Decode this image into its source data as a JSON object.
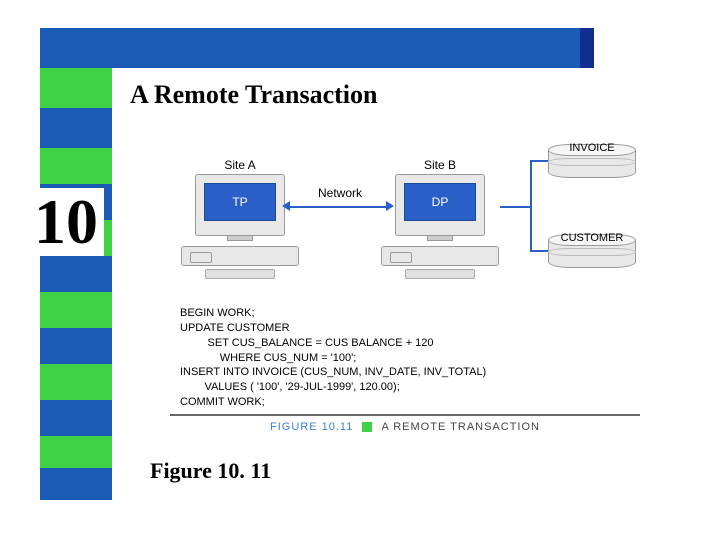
{
  "chapter_number": "10",
  "title": "A Remote Transaction",
  "caption": "Figure 10. 11",
  "diagram": {
    "siteA": {
      "label": "Site A",
      "role": "TP"
    },
    "siteB": {
      "label": "Site B",
      "role": "DP"
    },
    "network_label": "Network",
    "cylinders": {
      "top": "INVOICE",
      "bottom": "CUSTOMER"
    },
    "figure_label": "FIGURE 10.11",
    "figure_title": "A REMOTE TRANSACTION"
  },
  "sql": {
    "l1": "BEGIN WORK;",
    "l2": "UPDATE CUSTOMER",
    "l3": "SET CUS_BALANCE = CUS BALANCE + 120",
    "l4": "WHERE CUS_NUM = '100';",
    "l5": "INSERT INTO INVOICE (CUS_NUM, INV_DATE, INV_TOTAL)",
    "l6": "VALUES ( '100', '29-JUL-1999', 120.00);",
    "l7": "COMMIT WORK;"
  }
}
